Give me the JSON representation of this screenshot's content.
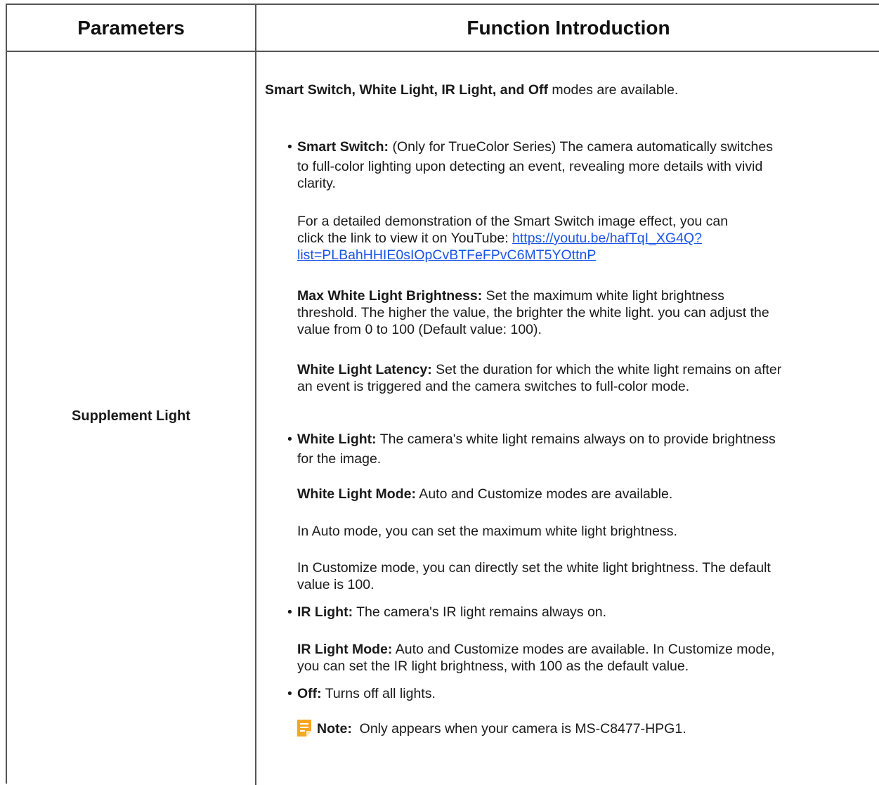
{
  "header": {
    "col1": "Parameters",
    "col2": "Function Introduction"
  },
  "row": {
    "parameter": "Supplement Light",
    "intro_bold": "Smart Switch, White Light, IR Light, and Off",
    "intro_rest": " modes are available.",
    "smart_switch": {
      "bullet": "•",
      "label": "Smart Switch:",
      "text_line1": " (Only for TrueColor Series) The camera automatically switches",
      "text_line2": "to full-color lighting upon detecting an event, revealing more details with vivid",
      "text_line3": "clarity.",
      "demo_line1": "For a detailed demonstration of the Smart Switch image effect, you can",
      "demo_line2": "click the link to view it on YouTube: ",
      "link_line1": "https://youtu.be/hafTqI_XG4Q?",
      "link_line2": "list=PLBahHHIE0sIOpCvBTFeFPvC6MT5YOttnP",
      "max_label": "Max White Light Brightness:",
      "max_line1": " Set the maximum white light brightness",
      "max_line2": "threshold. The higher the value, the brighter the white light. you can adjust the",
      "max_line3": "value from 0 to 100 (Default value: 100).",
      "latency_label": "White Light Latency:",
      "latency_line1": " Set the duration for which the white light remains on after",
      "latency_line2": "an event is triggered and the camera switches to full-color mode."
    },
    "white_light": {
      "bullet": "•",
      "label": "White Light:",
      "text_line1": " The camera's white light remains always on to provide brightness",
      "text_line2": "for the image.",
      "mode_label": "White Light Mode:",
      "mode_text": " Auto and Customize modes are available.",
      "auto_text": "In Auto mode, you can set the maximum white light brightness.",
      "custom_line1": "In Customize mode, you can directly set the white light brightness. The default",
      "custom_line2": "value is 100."
    },
    "ir_light": {
      "bullet": "•",
      "label": "IR Light:",
      "text": " The camera's IR light remains always on.",
      "mode_label": "IR Light Mode:",
      "mode_line1": " Auto and Customize modes are available. In Customize mode,",
      "mode_line2": "you can set the IR light brightness, with 100 as the default value."
    },
    "off": {
      "bullet": "•",
      "label": "Off:",
      "text": " Turns off all lights."
    },
    "note": {
      "icon": "note-icon",
      "label": "Note:",
      "text": "  Only appears when your camera is MS-C8477-HPG1."
    }
  },
  "colors": {
    "border": "#555555",
    "link": "#1a55e6",
    "note_icon": "#f5a623"
  }
}
